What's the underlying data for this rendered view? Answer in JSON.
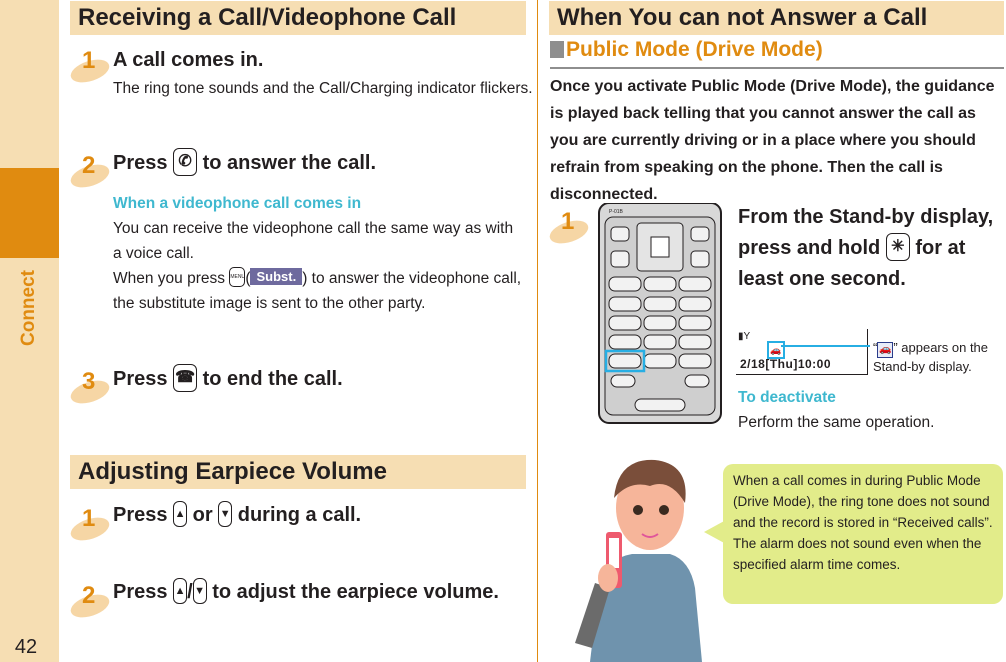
{
  "sidebar": {
    "chapter_label": "Connect",
    "page_number": "42"
  },
  "left": {
    "receiving": {
      "title": "Receiving a Call/Videophone Call",
      "steps": [
        {
          "num": "1",
          "title": "A call comes in.",
          "body": "The ring tone sounds and the Call/Charging indicator flickers."
        },
        {
          "num": "2",
          "title_pre": "Press",
          "title_post": "to answer the call.",
          "key_icon": "call-key",
          "sub_heading": "When a videophone call comes in",
          "body_1": "You can receive the videophone call the same way as with a voice call.",
          "body_2_pre": "When you press",
          "menu_key": "MENU",
          "softkey": "Subst.",
          "body_2_post": ") to answer the videophone call, the substitute image is sent to the other party."
        },
        {
          "num": "3",
          "title_pre": "Press",
          "title_post": "to end the call.",
          "key_icon": "end-call-key"
        }
      ]
    },
    "volume": {
      "title": "Adjusting Earpiece Volume",
      "steps": [
        {
          "num": "1",
          "title_pre": "Press",
          "or": "or",
          "title_post": "during a call.",
          "up": "▲",
          "down": "▼"
        },
        {
          "num": "2",
          "title_pre": "Press",
          "sep": "/",
          "title_post": "to adjust the earpiece volume.",
          "up": "▲",
          "down": "▼"
        }
      ]
    }
  },
  "right": {
    "title": "When You can not Answer a Call",
    "public_mode": {
      "heading": "Public Mode (Drive Mode)",
      "intro": "Once you activate Public Mode (Drive Mode), the guidance is played back telling that you cannot answer the call as you are currently driving or in a place where you should refrain from speaking on the phone. Then the call is disconnected.",
      "step": {
        "num": "1",
        "title_pre": "From the Stand-by display, press and hold",
        "key": "✳",
        "title_post": "for at least one second.",
        "standby_datetime": "2/18[Thu]10:00",
        "callout_pre": "“",
        "callout_post": "” appears on the Stand-by display.",
        "deactivate_heading": "To deactivate",
        "deactivate_body": "Perform the same operation."
      },
      "phone_model": "P-01B",
      "note": "When a call comes in during Public Mode (Drive Mode), the ring tone does not sound and the record is stored in “Received calls”. The alarm does not sound even when the specified alarm time comes."
    }
  },
  "colors": {
    "accent": "#e08b10",
    "tab_bg": "#f6deb3",
    "cyan": "#3fb8cf",
    "bubble": "#e2ec8a"
  }
}
